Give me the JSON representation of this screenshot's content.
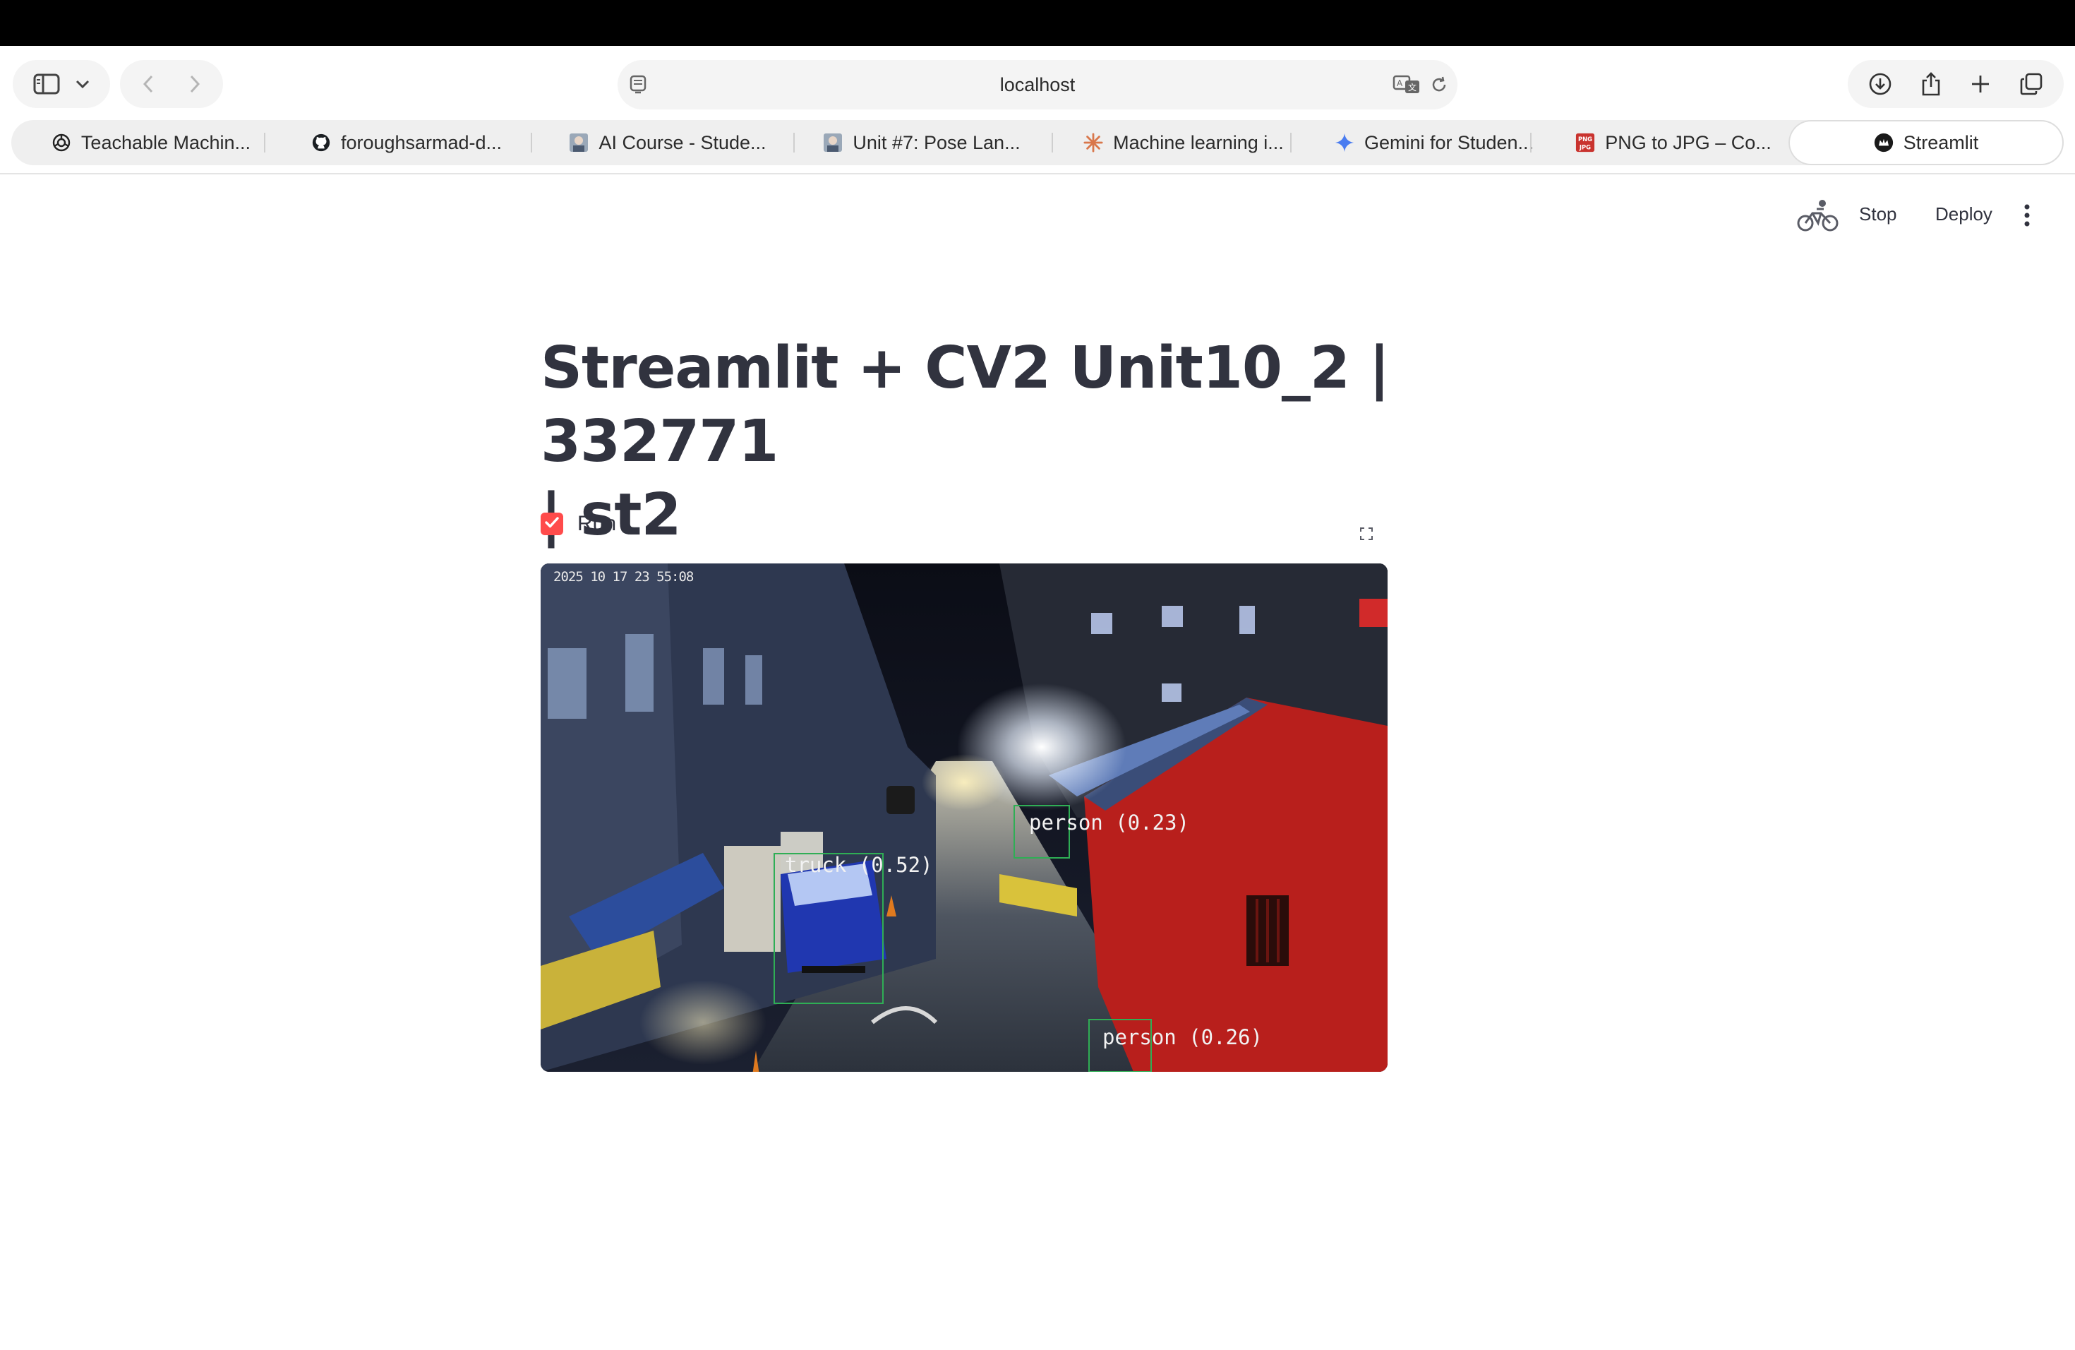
{
  "browser": {
    "url": "localhost",
    "tabs": [
      {
        "label": "Teachable Machin...",
        "icon": "openai-icon"
      },
      {
        "label": "foroughsarmad-d...",
        "icon": "github-icon"
      },
      {
        "label": "AI Course - Stude...",
        "icon": "course-thumbnail-icon"
      },
      {
        "label": "Unit #7: Pose Lan...",
        "icon": "course-thumbnail-icon"
      },
      {
        "label": "Machine learning i...",
        "icon": "starburst-icon"
      },
      {
        "label": "Gemini for Studen...",
        "icon": "gemini-sparkle-icon"
      },
      {
        "label": "PNG to JPG – Co...",
        "icon": "png-jpg-icon"
      },
      {
        "label": "Streamlit",
        "icon": "streamlit-crown-icon",
        "active": true
      }
    ],
    "png_icon_text": "PNG JPG"
  },
  "app_header": {
    "running_icon": "bicycle-icon",
    "stop_label": "Stop",
    "deploy_label": "Deploy",
    "menu_icon": "vertical-dots-icon"
  },
  "main": {
    "title_line1": "Streamlit + CV2 Unit10_2 | 332771",
    "title_line2": "| st2",
    "run_checkbox": {
      "label": "Run",
      "checked": true
    },
    "video_frame": {
      "timestamp": "2025 10 17 23 55:08",
      "detections": [
        {
          "label": "truck (0.52)"
        },
        {
          "label": "person (0.23)"
        },
        {
          "label": "person (0.26)"
        }
      ]
    }
  },
  "colors": {
    "accent": "#ff4b4b",
    "text": "#31333f",
    "detection_box": "#2fae55"
  }
}
